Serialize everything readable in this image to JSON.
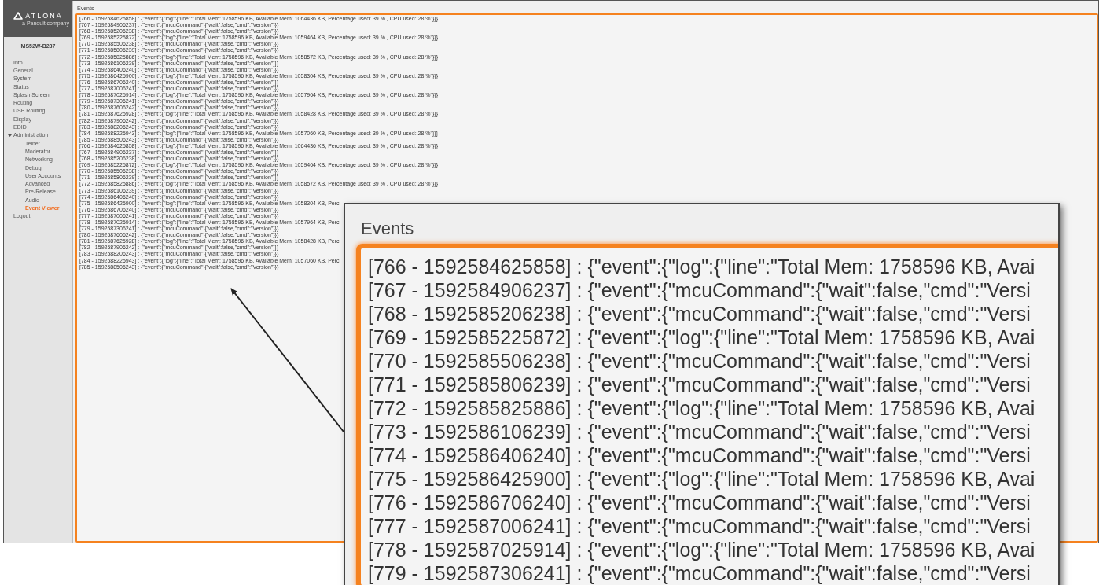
{
  "sidebar": {
    "logo": {
      "name": "ATLONA",
      "tagline": "a Panduit company"
    },
    "device": "MS52W-B287",
    "items": [
      {
        "label": "Info",
        "selected": false
      },
      {
        "label": "General",
        "selected": false
      },
      {
        "label": "System",
        "selected": false
      },
      {
        "label": "Status",
        "selected": false
      },
      {
        "label": "Splash Screen",
        "selected": false
      },
      {
        "label": "Routing",
        "selected": false
      },
      {
        "label": "USB Routing",
        "selected": false
      },
      {
        "label": "Display",
        "selected": false
      },
      {
        "label": "EDID",
        "selected": false
      },
      {
        "label": "Administration",
        "selected": false,
        "expanded": true,
        "children": [
          {
            "label": "Telnet",
            "selected": false
          },
          {
            "label": "Moderator",
            "selected": false
          },
          {
            "label": "Networking",
            "selected": false
          },
          {
            "label": "Debug",
            "selected": false
          },
          {
            "label": "User Accounts",
            "selected": false
          },
          {
            "label": "Advanced",
            "selected": false
          },
          {
            "label": "Pre-Release",
            "selected": false
          },
          {
            "label": "Audio",
            "selected": false
          },
          {
            "label": "Event Viewer",
            "selected": true
          }
        ]
      },
      {
        "label": "Logout",
        "selected": false
      }
    ]
  },
  "events": {
    "title": "Events",
    "lines": [
      "[766 - 1592584625858] : {\"event\":{\"log\":{\"line\":\"Total Mem: 1758596 KB, Available Mem: 1064436 KB, Percentage used: 39 % , CPU used: 28 %\"}}}",
      "[767 - 1592584906237] : {\"event\":{\"mcuCommand\":{\"wait\":false,\"cmd\":\"Version\"}}}",
      "[768 - 1592585206238] : {\"event\":{\"mcuCommand\":{\"wait\":false,\"cmd\":\"Version\"}}}",
      "[769 - 1592585225872] : {\"event\":{\"log\":{\"line\":\"Total Mem: 1758596 KB, Available Mem: 1059464 KB, Percentage used: 39 % , CPU used: 28 %\"}}}",
      "[770 - 1592585506238] : {\"event\":{\"mcuCommand\":{\"wait\":false,\"cmd\":\"Version\"}}}",
      "[771 - 1592585806239] : {\"event\":{\"mcuCommand\":{\"wait\":false,\"cmd\":\"Version\"}}}",
      "[772 - 1592585825886] : {\"event\":{\"log\":{\"line\":\"Total Mem: 1758596 KB, Available Mem: 1058572 KB, Percentage used: 39 % , CPU used: 28 %\"}}}",
      "[773 - 1592586106239] : {\"event\":{\"mcuCommand\":{\"wait\":false,\"cmd\":\"Version\"}}}",
      "[774 - 1592586406240] : {\"event\":{\"mcuCommand\":{\"wait\":false,\"cmd\":\"Version\"}}}",
      "[775 - 1592586425900] : {\"event\":{\"log\":{\"line\":\"Total Mem: 1758596 KB, Available Mem: 1058304 KB, Percentage used: 39 % , CPU used: 28 %\"}}}",
      "[776 - 1592586706240] : {\"event\":{\"mcuCommand\":{\"wait\":false,\"cmd\":\"Version\"}}}",
      "[777 - 1592587006241] : {\"event\":{\"mcuCommand\":{\"wait\":false,\"cmd\":\"Version\"}}}",
      "[778 - 1592587025914] : {\"event\":{\"log\":{\"line\":\"Total Mem: 1758596 KB, Available Mem: 1057964 KB, Percentage used: 39 % , CPU used: 28 %\"}}}",
      "[779 - 1592587306241] : {\"event\":{\"mcuCommand\":{\"wait\":false,\"cmd\":\"Version\"}}}",
      "[780 - 1592587606242] : {\"event\":{\"mcuCommand\":{\"wait\":false,\"cmd\":\"Version\"}}}",
      "[781 - 1592587625928] : {\"event\":{\"log\":{\"line\":\"Total Mem: 1758596 KB, Available Mem: 1058428 KB, Percentage used: 39 % , CPU used: 28 %\"}}}",
      "[782 - 1592587906242] : {\"event\":{\"mcuCommand\":{\"wait\":false,\"cmd\":\"Version\"}}}",
      "[783 - 1592588206243] : {\"event\":{\"mcuCommand\":{\"wait\":false,\"cmd\":\"Version\"}}}",
      "[784 - 1592588225943] : {\"event\":{\"log\":{\"line\":\"Total Mem: 1758596 KB, Available Mem: 1057060 KB, Percentage used: 39 % , CPU used: 28 %\"}}}",
      "[785 - 1592588506243] : {\"event\":{\"mcuCommand\":{\"wait\":false,\"cmd\":\"Version\"}}}",
      "[766 - 1592584625858] : {\"event\":{\"log\":{\"line\":\"Total Mem: 1758596 KB, Available Mem: 1064436 KB, Percentage used: 39 % , CPU used: 28 %\"}}}",
      "[767 - 1592584906237] : {\"event\":{\"mcuCommand\":{\"wait\":false,\"cmd\":\"Version\"}}}",
      "[768 - 1592585206238] : {\"event\":{\"mcuCommand\":{\"wait\":false,\"cmd\":\"Version\"}}}",
      "[769 - 1592585225872] : {\"event\":{\"log\":{\"line\":\"Total Mem: 1758596 KB, Available Mem: 1059464 KB, Percentage used: 39 % , CPU used: 28 %\"}}}",
      "[770 - 1592585506238] : {\"event\":{\"mcuCommand\":{\"wait\":false,\"cmd\":\"Version\"}}}",
      "[771 - 1592585806239] : {\"event\":{\"mcuCommand\":{\"wait\":false,\"cmd\":\"Version\"}}}",
      "[772 - 1592585825886] : {\"event\":{\"log\":{\"line\":\"Total Mem: 1758596 KB, Available Mem: 1058572 KB, Percentage used: 39 % , CPU used: 28 %\"}}}",
      "[773 - 1592586106239] : {\"event\":{\"mcuCommand\":{\"wait\":false,\"cmd\":\"Version\"}}}",
      "[774 - 1592586406240] : {\"event\":{\"mcuCommand\":{\"wait\":false,\"cmd\":\"Version\"}}}",
      "[775 - 1592586425900] : {\"event\":{\"log\":{\"line\":\"Total Mem: 1758596 KB, Available Mem: 1058304 KB, Perc",
      "[776 - 1592586706240] : {\"event\":{\"mcuCommand\":{\"wait\":false,\"cmd\":\"Version\"}}}",
      "[777 - 1592587006241] : {\"event\":{\"mcuCommand\":{\"wait\":false,\"cmd\":\"Version\"}}}",
      "[778 - 1592587025914] : {\"event\":{\"log\":{\"line\":\"Total Mem: 1758596 KB, Available Mem: 1057964 KB, Perc",
      "[779 - 1592587306241] : {\"event\":{\"mcuCommand\":{\"wait\":false,\"cmd\":\"Version\"}}}",
      "[780 - 1592587606242] : {\"event\":{\"mcuCommand\":{\"wait\":false,\"cmd\":\"Version\"}}}",
      "[781 - 1592587625928] : {\"event\":{\"log\":{\"line\":\"Total Mem: 1758596 KB, Available Mem: 1058428 KB, Perc",
      "[782 - 1592587906242] : {\"event\":{\"mcuCommand\":{\"wait\":false,\"cmd\":\"Version\"}}}",
      "[783 - 1592588206243] : {\"event\":{\"mcuCommand\":{\"wait\":false,\"cmd\":\"Version\"}}}",
      "[784 - 1592588225943] : {\"event\":{\"log\":{\"line\":\"Total Mem: 1758596 KB, Available Mem: 1057060 KB, Perc",
      "[785 - 1592588506243] : {\"event\":{\"mcuCommand\":{\"wait\":false,\"cmd\":\"Version\"}}}"
    ]
  },
  "callout": {
    "title": "Events",
    "lines": [
      "[766 - 1592584625858] : {\"event\":{\"log\":{\"line\":\"Total Mem: 1758596 KB, Avai",
      "[767 - 1592584906237] : {\"event\":{\"mcuCommand\":{\"wait\":false,\"cmd\":\"Versi",
      "[768 - 1592585206238] : {\"event\":{\"mcuCommand\":{\"wait\":false,\"cmd\":\"Versi",
      "[769 - 1592585225872] : {\"event\":{\"log\":{\"line\":\"Total Mem: 1758596 KB, Avai",
      "[770 - 1592585506238] : {\"event\":{\"mcuCommand\":{\"wait\":false,\"cmd\":\"Versi",
      "[771 - 1592585806239] : {\"event\":{\"mcuCommand\":{\"wait\":false,\"cmd\":\"Versi",
      "[772 - 1592585825886] : {\"event\":{\"log\":{\"line\":\"Total Mem: 1758596 KB, Avai",
      "[773 - 1592586106239] : {\"event\":{\"mcuCommand\":{\"wait\":false,\"cmd\":\"Versi",
      "[774 - 1592586406240] : {\"event\":{\"mcuCommand\":{\"wait\":false,\"cmd\":\"Versi",
      "[775 - 1592586425900] : {\"event\":{\"log\":{\"line\":\"Total Mem: 1758596 KB, Avai",
      "[776 - 1592586706240] : {\"event\":{\"mcuCommand\":{\"wait\":false,\"cmd\":\"Versi",
      "[777 - 1592587006241] : {\"event\":{\"mcuCommand\":{\"wait\":false,\"cmd\":\"Versi",
      "[778 - 1592587025914] : {\"event\":{\"log\":{\"line\":\"Total Mem: 1758596 KB, Avai",
      "[779 - 1592587306241] : {\"event\":{\"mcuCommand\":{\"wait\":false,\"cmd\":\"Versi"
    ]
  }
}
